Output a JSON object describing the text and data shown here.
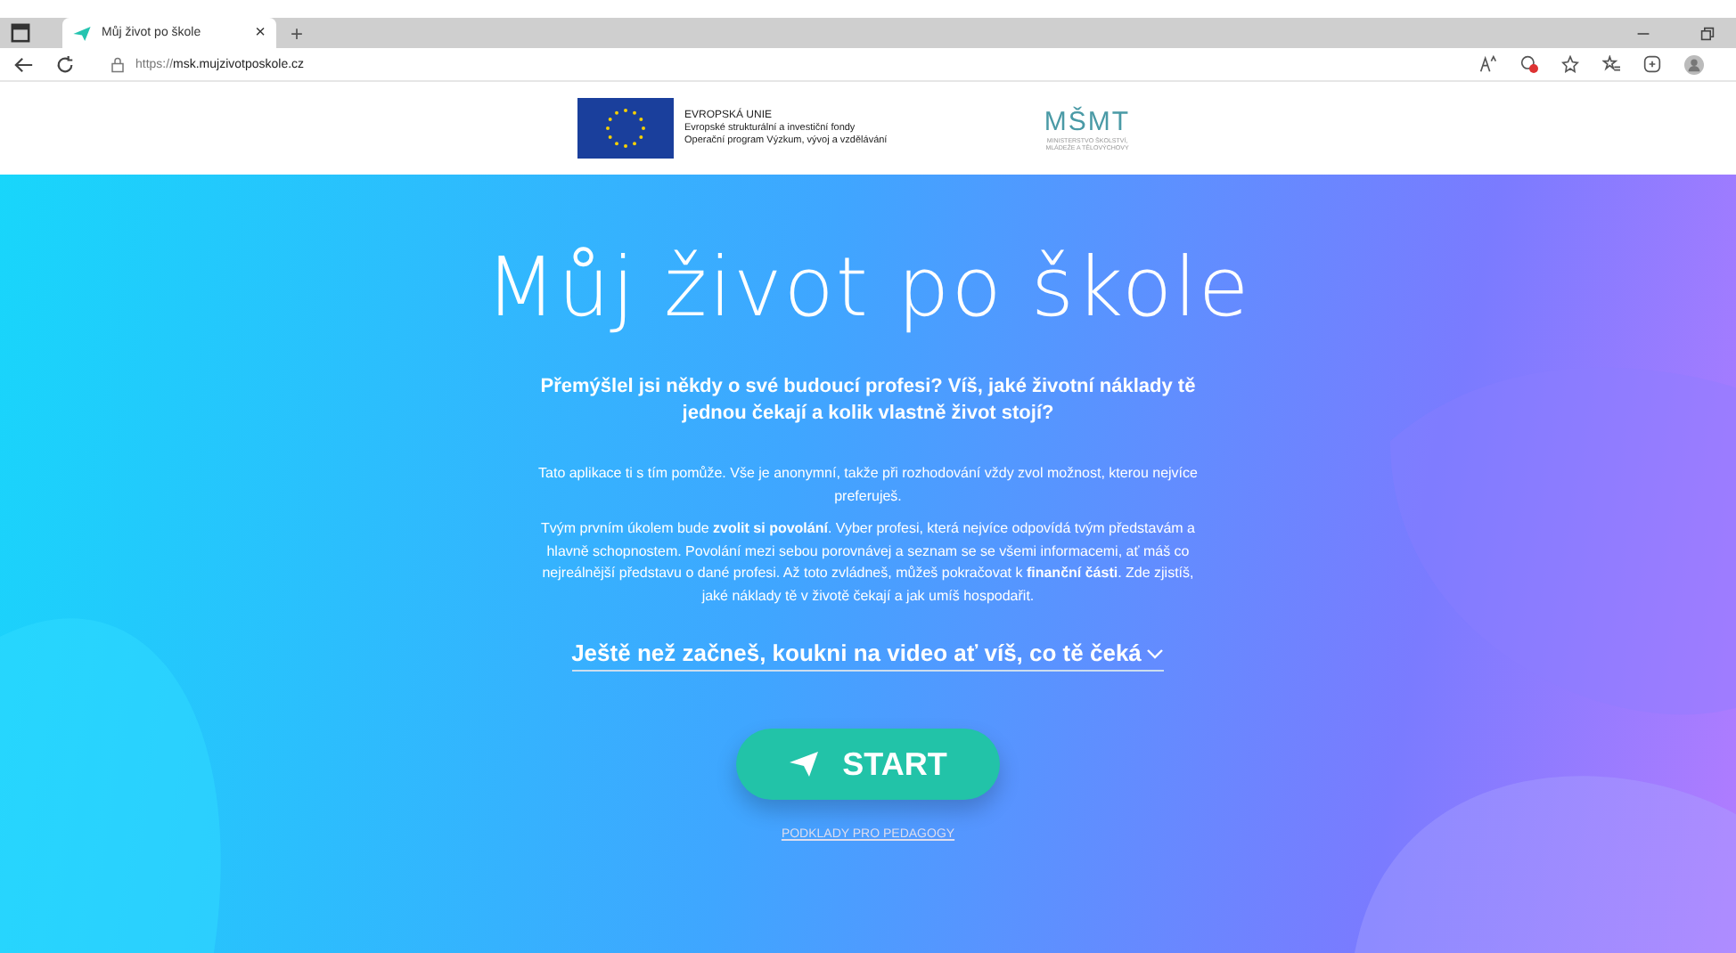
{
  "browser": {
    "tab": {
      "title": "Můj život po škole",
      "close": "×",
      "selected": true
    },
    "new_tab": "+",
    "url_prefix": "https://",
    "url_host": "msk.mujzivotposkole.cz"
  },
  "logos": {
    "eu_lines": [
      "EVROPSKÁ UNIE",
      "Evropské strukturální a investiční fondy",
      "Operační program Výzkum, vývoj a vzdělávání"
    ],
    "msmt_mark": "MŠMT",
    "msmt_lines": [
      "MINISTERSTVO ŠKOLSTVÍ,",
      "MLÁDEŽE A TĚLOVÝCHOVY"
    ]
  },
  "hero": {
    "title": "Můj život po škole",
    "lead": "Přemýšlel jsi někdy o své budoucí profesi? Víš, jaké životní náklady tě jednou čekají a kolik vlastně život stojí?",
    "paragraphs": [
      "Tato aplikace ti s tím pomůže. Vše je anonymní, takže při rozhodování vždy zvol možnost, kterou nejvíce preferuješ.",
      "Tvým prvním úkolem bude **zvolit si povolání**. Vyber profesi, která nejvíce odpovídá tvým představám a hlavně schopnostem. Povolání mezi sebou porovnávej a seznam se se všemi informacemi, ať máš co nejreálnější představu o dané profesi. Až toto zvládneš, můžeš pokračovat k **finanční části**. Zde zjistíš, jaké náklady tě v životě čekají a jak umíš hospodařit."
    ],
    "video_link": "Ještě než začneš, koukni na video ať víš, co tě čeká",
    "start": "START",
    "teachers_link": "PODKLADY PRO PEDAGOGY"
  }
}
